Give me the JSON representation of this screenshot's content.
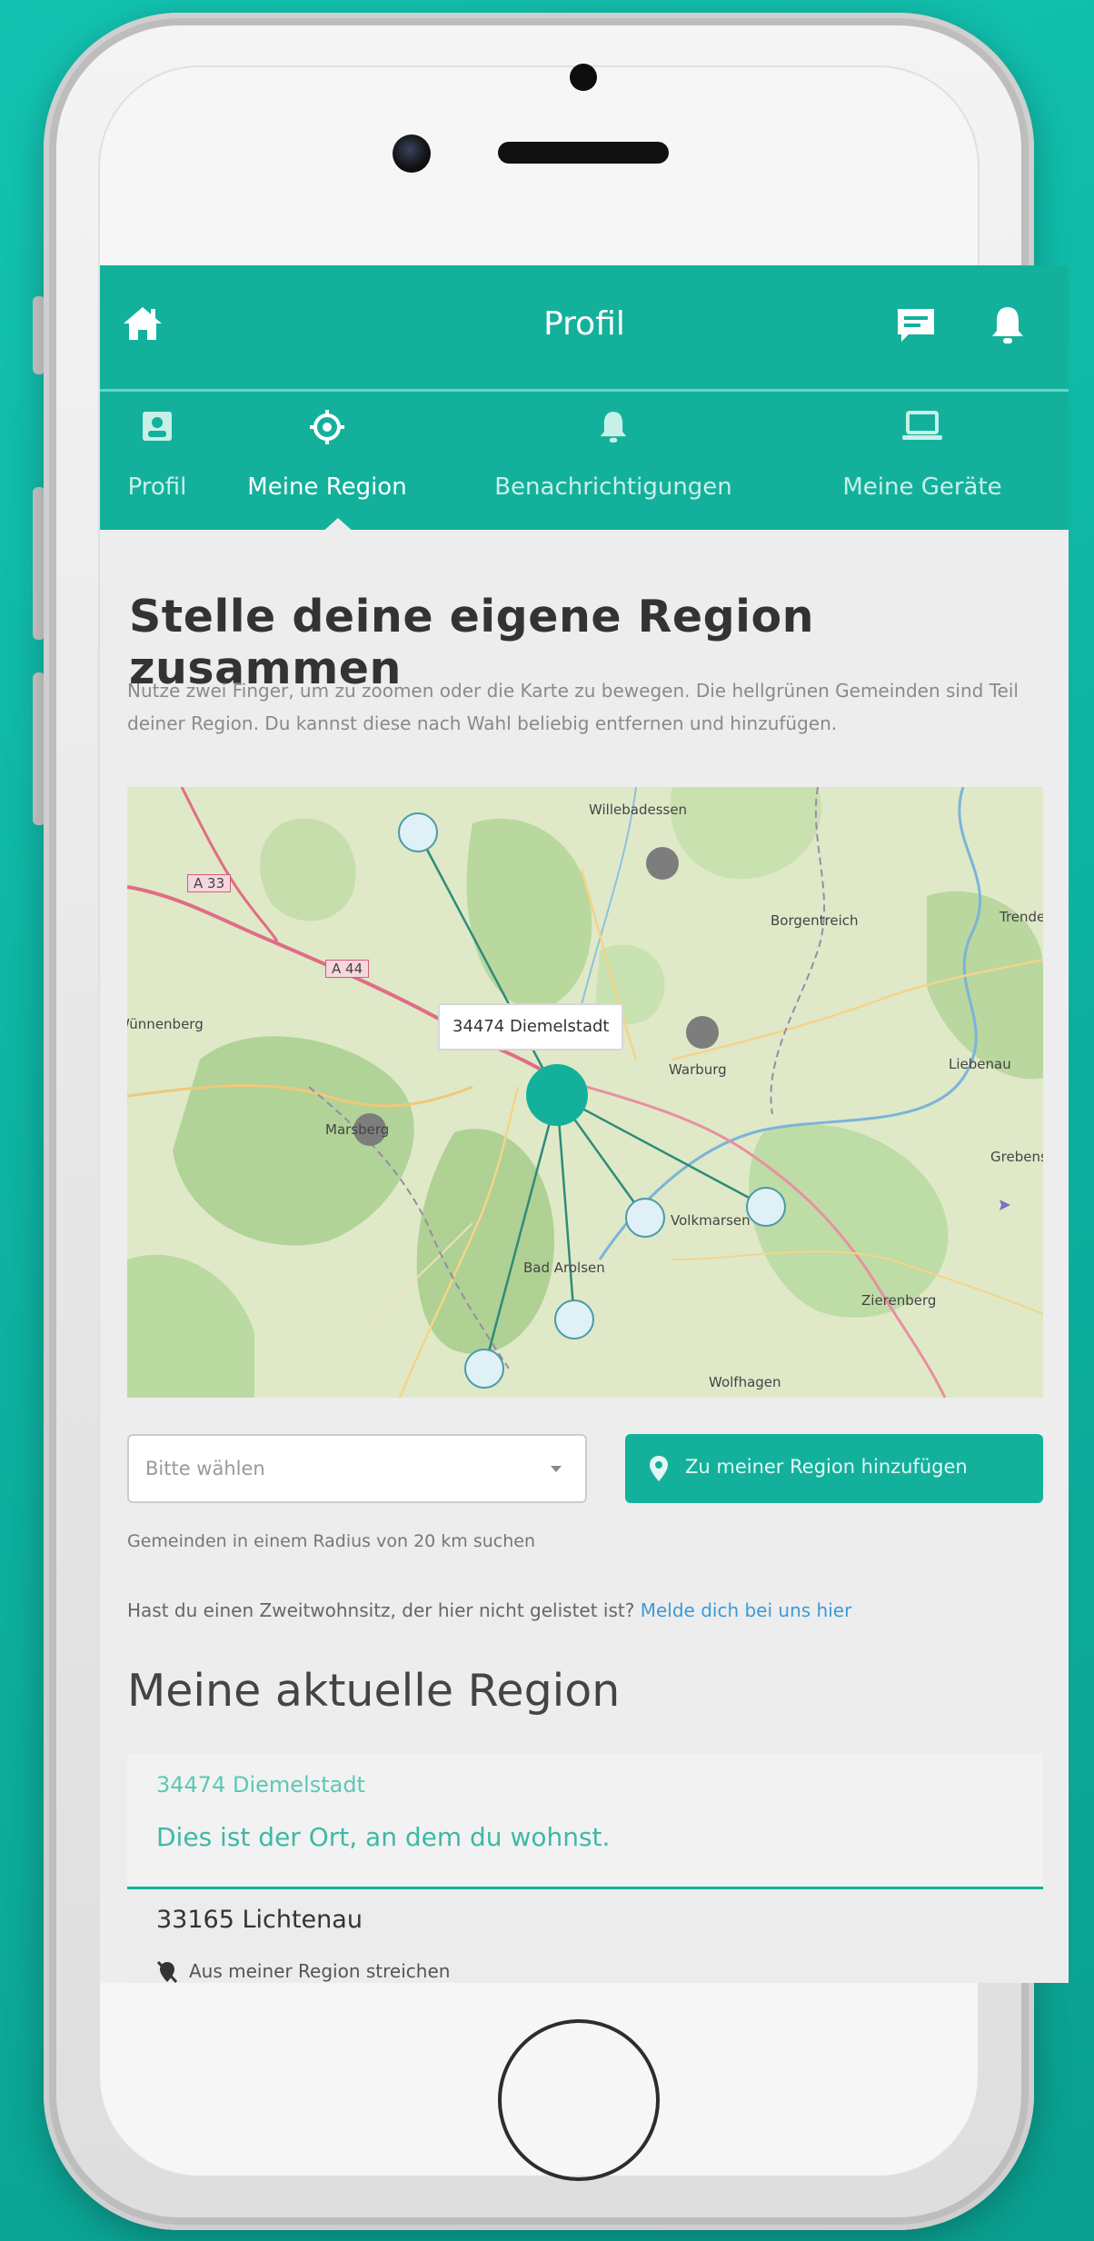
{
  "header": {
    "title": "Profil"
  },
  "tabs": [
    {
      "label": "Profil",
      "icon": "profile-card-icon"
    },
    {
      "label": "Meine Region",
      "icon": "target-icon"
    },
    {
      "label": "Benachrichtigungen",
      "icon": "bell-icon"
    },
    {
      "label": "Meine Geräte",
      "icon": "laptop-icon"
    }
  ],
  "active_tab": "Meine Region",
  "region_builder": {
    "heading": "Stelle deine eigene Region zusammen",
    "description": "Nutze zwei Finger, um zu zoomen oder die Karte zu bewegen. Die hellgrünen Gemeinden sind Teil deiner Region. Du kannst diese nach Wahl beliebig entfernen und hinzufügen."
  },
  "map": {
    "tooltip": "34474 Diemelstadt",
    "place_labels": [
      "Willebadessen",
      "Borgentreich",
      "Warburg",
      "Marsberg",
      "Bad Arolsen",
      "Volkmarsen",
      "Zierenberg",
      "Wolfhagen",
      "Wünnenberg",
      "Trendelburg",
      "Liebenau",
      "Grebenstein"
    ],
    "road_labels": [
      "A 33",
      "A 44"
    ],
    "colors": {
      "selected": "#13b19c",
      "included": "#dff1f6",
      "available": "#7d7d7d"
    }
  },
  "controls": {
    "select_placeholder": "Bitte wählen",
    "add_button": "Zu meiner Region hinzufügen",
    "radius_text": "Gemeinden in einem Radius von 20 km suchen",
    "second_home_text": "Hast du einen Zweitwohnsitz, der hier nicht gelistet ist?",
    "second_home_link": "Melde dich bei uns hier"
  },
  "current_region": {
    "heading": "Meine aktuelle Region",
    "home": {
      "plz": "34474 Diemelstadt",
      "note": "Dies ist der Ort, an dem du wohnst."
    },
    "items": [
      {
        "name": "33165 Lichtenau",
        "action": "Aus meiner Region streichen"
      }
    ]
  },
  "colors": {
    "brand": "#13b19c",
    "background": "#0fb8a6",
    "link": "#3b9ad8"
  }
}
